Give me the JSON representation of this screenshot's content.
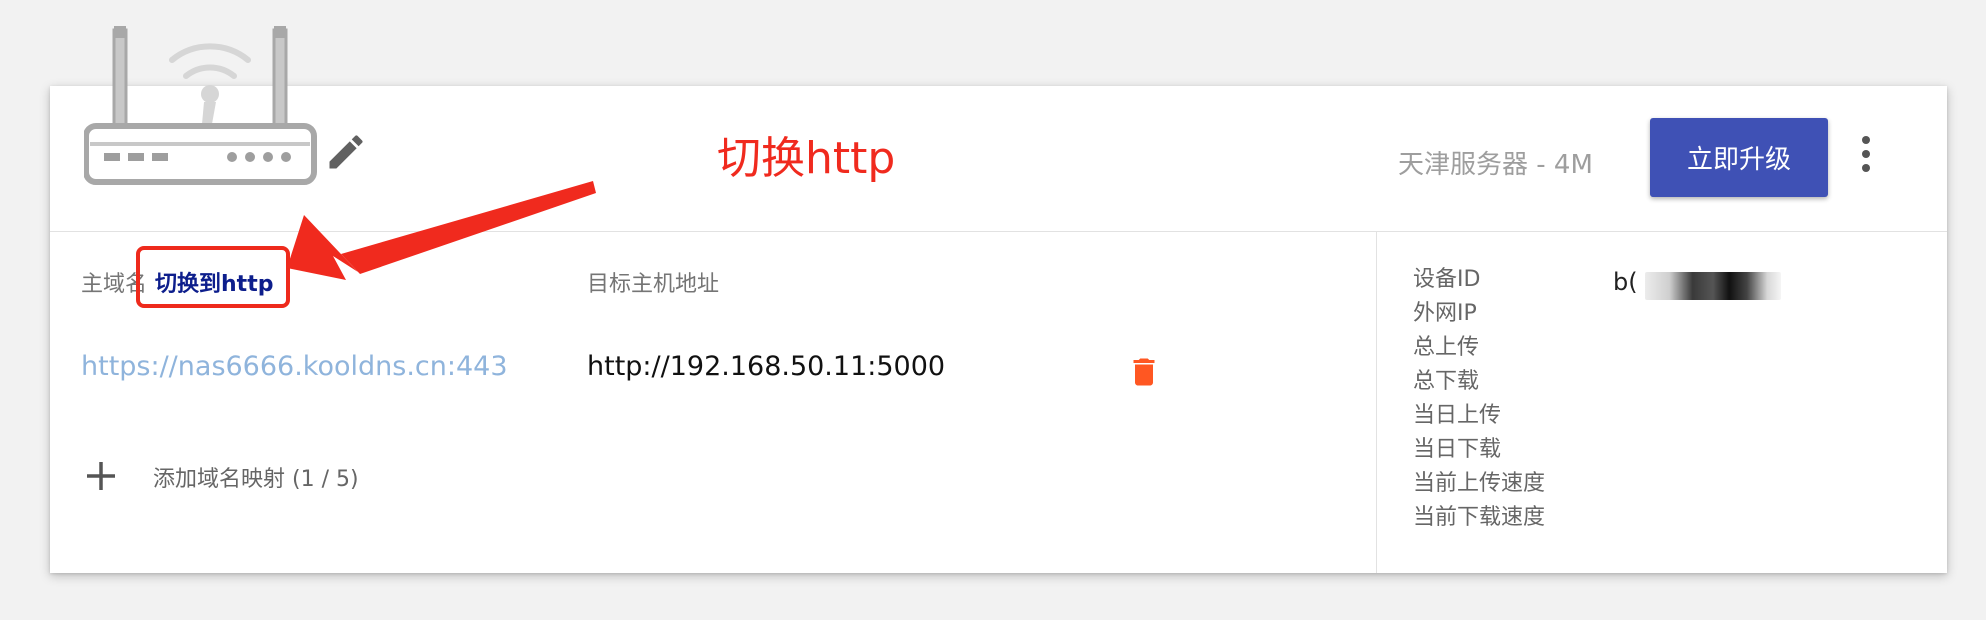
{
  "header": {
    "server_label": "天津服务器 - 4M",
    "upgrade_label": "立即升级",
    "router_icon": "router-icon",
    "edit_icon": "edit-icon",
    "more_icon": "more-vert-icon"
  },
  "columns": {
    "domain_label": "主域名",
    "switch_label": "切换到http",
    "target_label": "目标主机地址"
  },
  "mapping": {
    "domain": "https://nas6666.kooldns.cn:443",
    "target": "http://192.168.50.11:5000",
    "delete_icon": "trash-icon"
  },
  "add": {
    "label": "添加域名映射 (1 / 5)",
    "icon": "plus-icon"
  },
  "info": {
    "labels": [
      "设备ID",
      "外网IP",
      "总上传",
      "总下载",
      "当日上传",
      "当日下载",
      "当前上传速度",
      "当前下载速度"
    ],
    "device_id_prefix": "b("
  },
  "annotation": {
    "text": "切换http"
  },
  "colors": {
    "accent": "#3f51b5",
    "annotation": "#f02a1e",
    "delete": "#ff5722",
    "link": "#8fb4dc"
  }
}
